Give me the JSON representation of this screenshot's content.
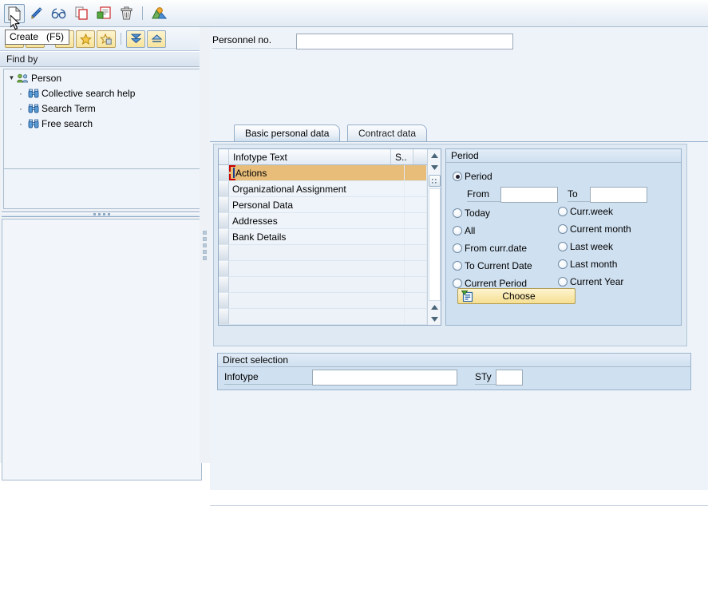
{
  "toolbar": {
    "buttons": [
      {
        "name": "create-icon",
        "tip": "Create (F5)"
      },
      {
        "name": "edit-icon",
        "tip": "Change"
      },
      {
        "name": "display-glasses-icon",
        "tip": "Display"
      },
      {
        "name": "copy-icon",
        "tip": "Copy"
      },
      {
        "name": "delimit-icon",
        "tip": "Delimit"
      },
      {
        "name": "delete-trash-icon",
        "tip": "Delete"
      },
      {
        "name": "overview-picture-icon",
        "tip": "Overview"
      }
    ],
    "tooltip": "Create   (F5)"
  },
  "sidebar": {
    "toolbar_buttons": [
      {
        "name": "back-arrow-icon"
      },
      {
        "name": "forward-arrow-icon"
      },
      {
        "name": "refresh-icon"
      },
      {
        "name": "add-favorite-star-icon"
      },
      {
        "name": "delete-favorite-star-icon"
      },
      {
        "name": "expand-all-icon"
      },
      {
        "name": "collapse-all-icon"
      }
    ],
    "find_by_title": "Find by",
    "tree": {
      "root_label": "Person",
      "children": [
        {
          "label": "Collective search help"
        },
        {
          "label": "Search Term"
        },
        {
          "label": "Free search"
        }
      ]
    }
  },
  "main": {
    "personnel_no": {
      "label": "Personnel no.",
      "value": "",
      "placeholder": ""
    },
    "tabs": [
      {
        "label": "Basic personal data",
        "active": true
      },
      {
        "label": "Contract data",
        "active": false
      }
    ],
    "infotype_table": {
      "columns": [
        "Infotype Text",
        "S.."
      ],
      "rows": [
        {
          "text": "Actions",
          "sty": "",
          "selected": true
        },
        {
          "text": "Organizational Assignment",
          "sty": "",
          "selected": false
        },
        {
          "text": "Personal Data",
          "sty": "",
          "selected": false
        },
        {
          "text": "Addresses",
          "sty": "",
          "selected": false
        },
        {
          "text": "Bank Details",
          "sty": "",
          "selected": false
        },
        {
          "text": "",
          "sty": "",
          "selected": false
        },
        {
          "text": "",
          "sty": "",
          "selected": false
        },
        {
          "text": "",
          "sty": "",
          "selected": false
        },
        {
          "text": "",
          "sty": "",
          "selected": false
        },
        {
          "text": "",
          "sty": "",
          "selected": false
        }
      ]
    },
    "period": {
      "title": "Period",
      "selected": "Period",
      "period_radio_label": "Period",
      "from_label": "From",
      "from_value": "",
      "to_label": "To",
      "to_value": "",
      "options_left": [
        "Today",
        "All",
        "From curr.date",
        "To Current Date",
        "Current Period"
      ],
      "options_right": [
        "Curr.week",
        "Current month",
        "Last week",
        "Last month",
        "Current Year"
      ],
      "choose_button": "Choose"
    },
    "direct_selection": {
      "title": "Direct selection",
      "infotype_label": "Infotype",
      "infotype_value": "",
      "sty_label": "STy",
      "sty_value": ""
    }
  },
  "colors": {
    "selected_row": "#e8bd7a",
    "selection_bracket": "#cc0000",
    "panel_bg": "#cfe0f0",
    "button_yellow": "#f6df91",
    "window_bg": "#eef3f9"
  }
}
